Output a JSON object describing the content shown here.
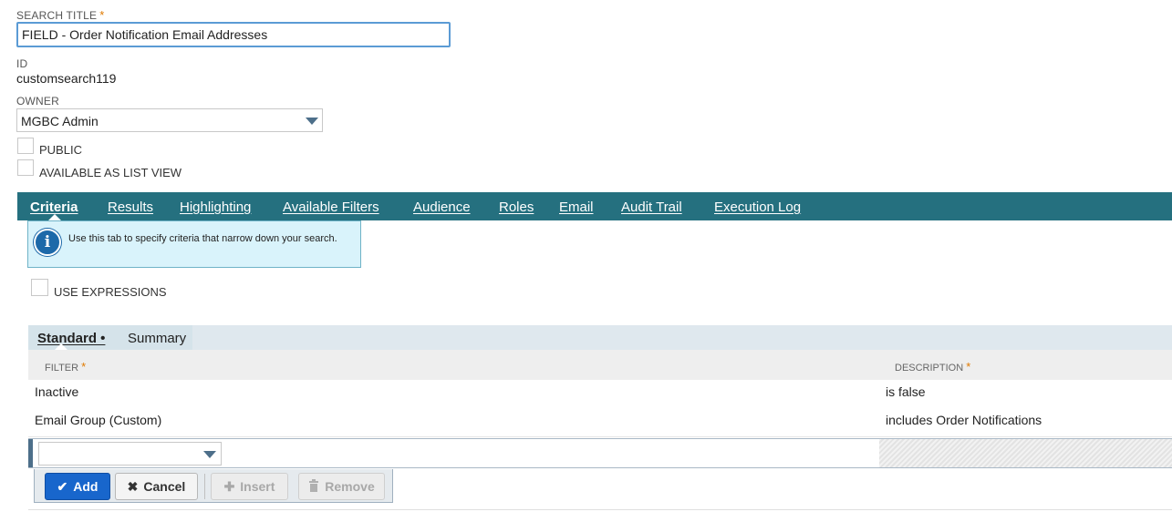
{
  "form": {
    "search_title_label": "SEARCH TITLE",
    "required_mark": "*",
    "search_title_value": "FIELD - Order Notification Email Addresses",
    "id_label": "ID",
    "id_value": "customsearch119",
    "owner_label": "OWNER",
    "owner_value": "MGBC Admin",
    "public_label": "PUBLIC",
    "list_view_label": "AVAILABLE AS LIST VIEW"
  },
  "tabs": [
    {
      "label": "Criteria",
      "active": true
    },
    {
      "label": "Results"
    },
    {
      "label": "Highlighting"
    },
    {
      "label": "Available Filters"
    },
    {
      "label": "Audience"
    },
    {
      "label": "Roles"
    },
    {
      "label": "Email"
    },
    {
      "label": "Audit Trail"
    },
    {
      "label": "Execution Log"
    }
  ],
  "info": {
    "icon": "info-icon",
    "text": "Use this tab to specify criteria that narrow down your search."
  },
  "use_expressions_label": "USE EXPRESSIONS",
  "subtabs": [
    {
      "label": "Standard •",
      "active": true
    },
    {
      "label": "Summary"
    }
  ],
  "grid": {
    "headers": {
      "filter": "FILTER",
      "description": "DESCRIPTION"
    },
    "rows": [
      {
        "filter": "Inactive",
        "description": "is false"
      },
      {
        "filter": "Email Group (Custom)",
        "description": "includes Order Notifications"
      }
    ]
  },
  "buttons": {
    "add": "Add",
    "cancel": "Cancel",
    "insert": "Insert",
    "remove": "Remove"
  },
  "colors": {
    "tabbar": "#25707f",
    "add_button": "#1866cc",
    "required": "#e07a00"
  }
}
